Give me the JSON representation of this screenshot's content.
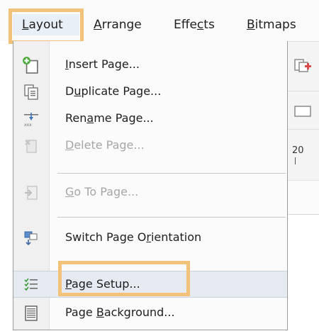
{
  "menubar": {
    "items": [
      {
        "pre": "",
        "u": "L",
        "post": "ayout"
      },
      {
        "pre": "",
        "u": "A",
        "post": "rrange"
      },
      {
        "pre": "Effe",
        "u": "c",
        "post": "ts"
      },
      {
        "pre": "",
        "u": "B",
        "post": "itmaps"
      }
    ]
  },
  "menu": {
    "items": [
      {
        "pre": "",
        "u": "I",
        "post": "nsert Page...",
        "icon": "insert-page-icon"
      },
      {
        "pre": "D",
        "u": "u",
        "post": "plicate Page...",
        "icon": "duplicate-page-icon"
      },
      {
        "pre": "Ren",
        "u": "a",
        "post": "me Page...",
        "icon": "rename-page-icon"
      },
      {
        "pre": "",
        "u": "D",
        "post": "elete Page...",
        "icon": "delete-page-icon",
        "disabled": true
      },
      {
        "pre": "",
        "u": "G",
        "post": "o To Page...",
        "icon": "go-to-page-icon",
        "disabled": true
      },
      {
        "pre": "Switch Page O",
        "u": "r",
        "post": "ientation",
        "icon": "switch-orientation-icon"
      },
      {
        "pre": "",
        "u": "P",
        "post": "age Setup...",
        "icon": "page-setup-icon",
        "selected": true
      },
      {
        "pre": "Page ",
        "u": "B",
        "post": "ackground...",
        "icon": "page-background-icon"
      }
    ]
  },
  "background": {
    "ruler_text": "20"
  }
}
